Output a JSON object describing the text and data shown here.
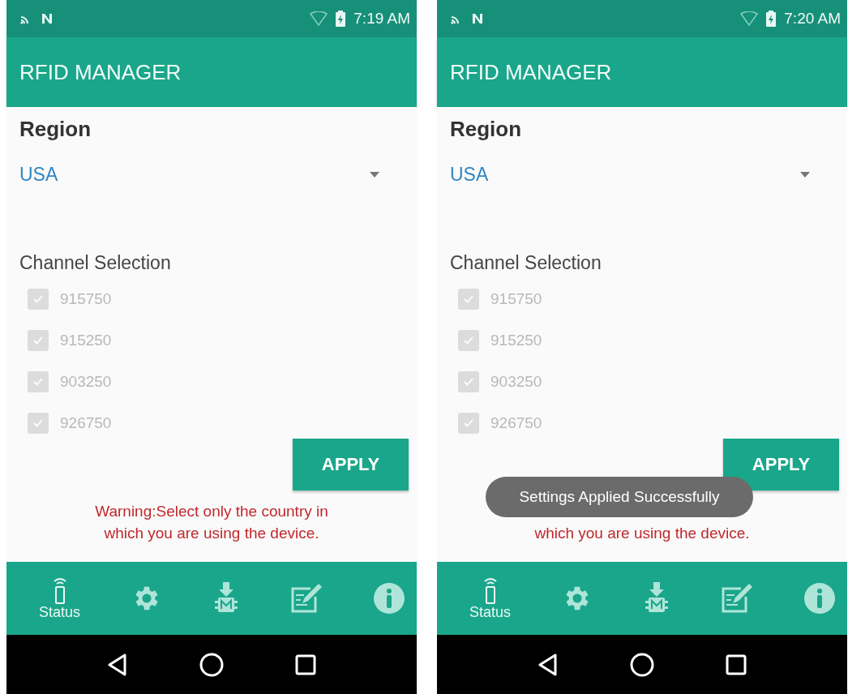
{
  "phones": [
    {
      "status_bar": {
        "time": "7:19 AM"
      },
      "app_bar": {
        "title": "RFID MANAGER"
      },
      "region": {
        "label": "Region",
        "value": "USA"
      },
      "channel_selection": {
        "label": "Channel Selection",
        "channels": [
          {
            "label": "915750",
            "checked": true,
            "disabled": true
          },
          {
            "label": "915250",
            "checked": true,
            "disabled": true
          },
          {
            "label": "903250",
            "checked": true,
            "disabled": true
          },
          {
            "label": "926750",
            "checked": true,
            "disabled": true
          }
        ]
      },
      "apply_button": "APPLY",
      "warning": "Warning:Select only the country in which you are using the device.",
      "bottom_nav": [
        {
          "kind": "status",
          "label": "Status",
          "selected": true
        },
        {
          "kind": "settings",
          "selected": false
        },
        {
          "kind": "firmware",
          "selected": false
        },
        {
          "kind": "edit",
          "selected": false
        },
        {
          "kind": "info",
          "selected": false
        }
      ]
    },
    {
      "status_bar": {
        "time": "7:20 AM"
      },
      "app_bar": {
        "title": "RFID MANAGER"
      },
      "region": {
        "label": "Region",
        "value": "USA"
      },
      "channel_selection": {
        "label": "Channel Selection",
        "channels": [
          {
            "label": "915750",
            "checked": true,
            "disabled": true
          },
          {
            "label": "915250",
            "checked": true,
            "disabled": true
          },
          {
            "label": "903250",
            "checked": true,
            "disabled": true
          },
          {
            "label": "926750",
            "checked": true,
            "disabled": true
          }
        ]
      },
      "apply_button": "APPLY",
      "warning": "which you are using the device.",
      "toast": "Settings Applied Successfully",
      "bottom_nav": [
        {
          "kind": "status",
          "label": "Status",
          "selected": true
        },
        {
          "kind": "settings",
          "selected": false
        },
        {
          "kind": "firmware",
          "selected": false
        },
        {
          "kind": "edit",
          "selected": false
        },
        {
          "kind": "info",
          "selected": false
        }
      ]
    }
  ]
}
